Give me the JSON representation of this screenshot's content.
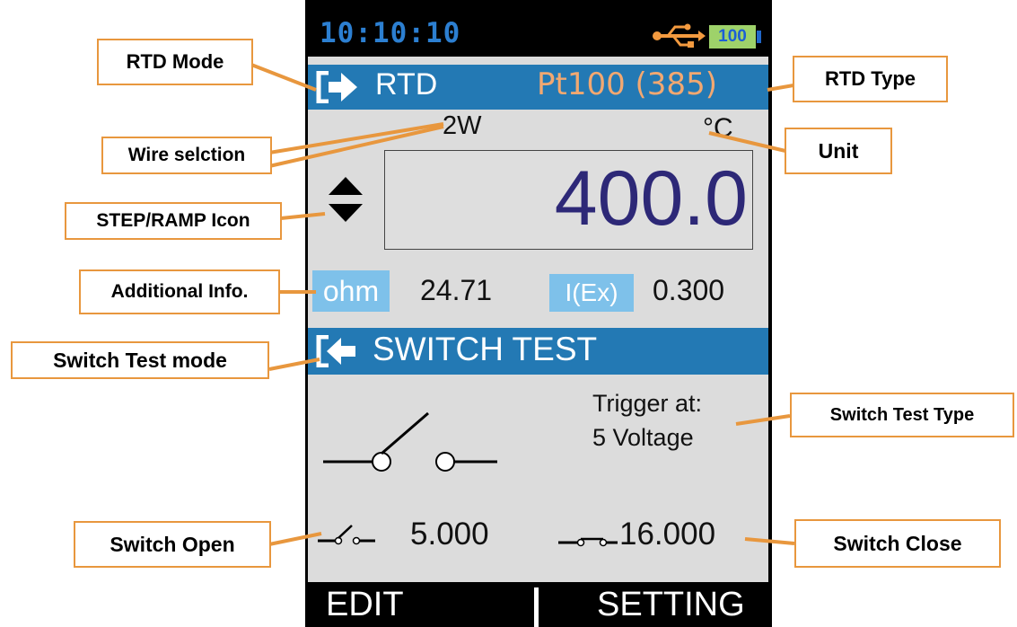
{
  "status": {
    "time": "10:10:10",
    "battery": "100",
    "usb_icon": "usb-icon"
  },
  "rtd": {
    "mode_icon": "input-arrow-icon",
    "mode_label": "RTD",
    "type": "Pt100 (385)",
    "wire": "2W",
    "unit": "°C",
    "step_ramp_icon": "up-down-triangle-icon",
    "value": "400.0"
  },
  "additional": {
    "ohm_label": "ohm",
    "ohm_value": "24.71",
    "iex_label": "I(Ex)",
    "iex_value": "0.300"
  },
  "switch_test": {
    "mode_icon": "output-arrow-icon",
    "label": "SWITCH TEST",
    "trigger_line1": "Trigger at:",
    "trigger_line2": "5 Voltage",
    "open_value": "5.000",
    "close_value": "16.000"
  },
  "softkeys": {
    "left": "EDIT",
    "right": "SETTING"
  },
  "callouts": {
    "rtd_mode": "RTD Mode",
    "rtd_type": "RTD Type",
    "wire_selection": "Wire selction",
    "unit": "Unit",
    "step_ramp": "STEP/RAMP Icon",
    "additional_info": "Additional Info.",
    "switch_test_mode": "Switch Test mode",
    "switch_test_type": "Switch Test Type",
    "switch_open": "Switch Open",
    "switch_close": "Switch Close"
  },
  "colors": {
    "bar_blue": "#2379b4",
    "screen_gray": "#dcdcdc",
    "value_navy": "#2d2877",
    "rtd_type_orange": "#f2a871",
    "tag_blue": "#7ec1ea",
    "time_blue": "#2c7fd1",
    "callout_border": "#e8973e"
  }
}
